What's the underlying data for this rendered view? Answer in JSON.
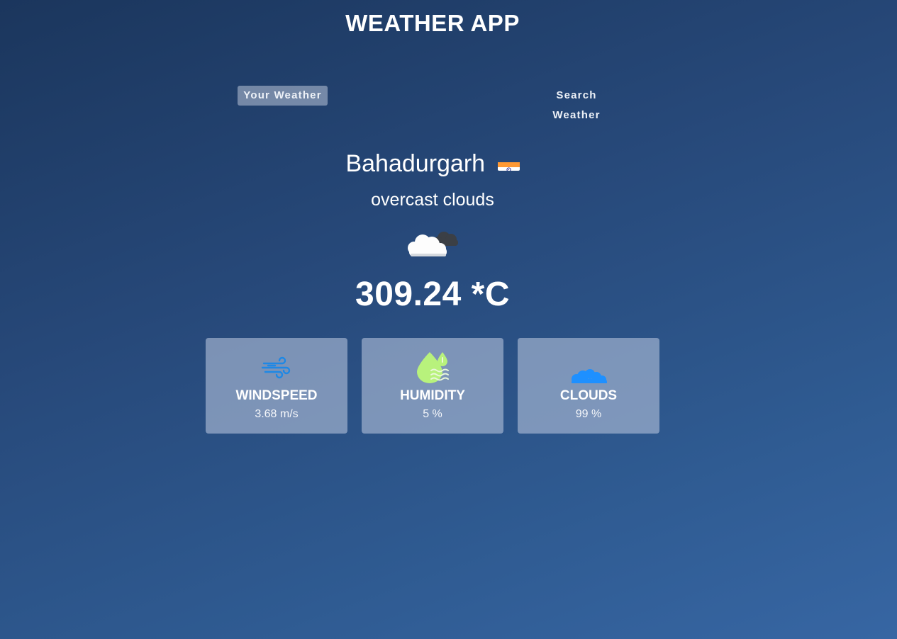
{
  "app": {
    "title": "WEATHER APP"
  },
  "tabs": [
    {
      "label": "Your Weather",
      "active": true
    },
    {
      "label": "Search Weather",
      "active": false
    }
  ],
  "weather": {
    "city": "Bahadurgarh",
    "country_flag": "flag-india-icon",
    "description": "overcast clouds",
    "condition_icon": "overcast-clouds-icon",
    "temperature": "309.24 *C"
  },
  "stats": [
    {
      "label": "WINDSPEED",
      "value": "3.68 m/s",
      "icon": "wind-icon",
      "icon_color": "#1e88e5"
    },
    {
      "label": "HUMIDITY",
      "value": "5 %",
      "icon": "humidity-icon",
      "icon_color": "#b2f27a"
    },
    {
      "label": "CLOUDS",
      "value": "99 %",
      "icon": "clouds-icon",
      "icon_color": "#1e90ff"
    }
  ]
}
